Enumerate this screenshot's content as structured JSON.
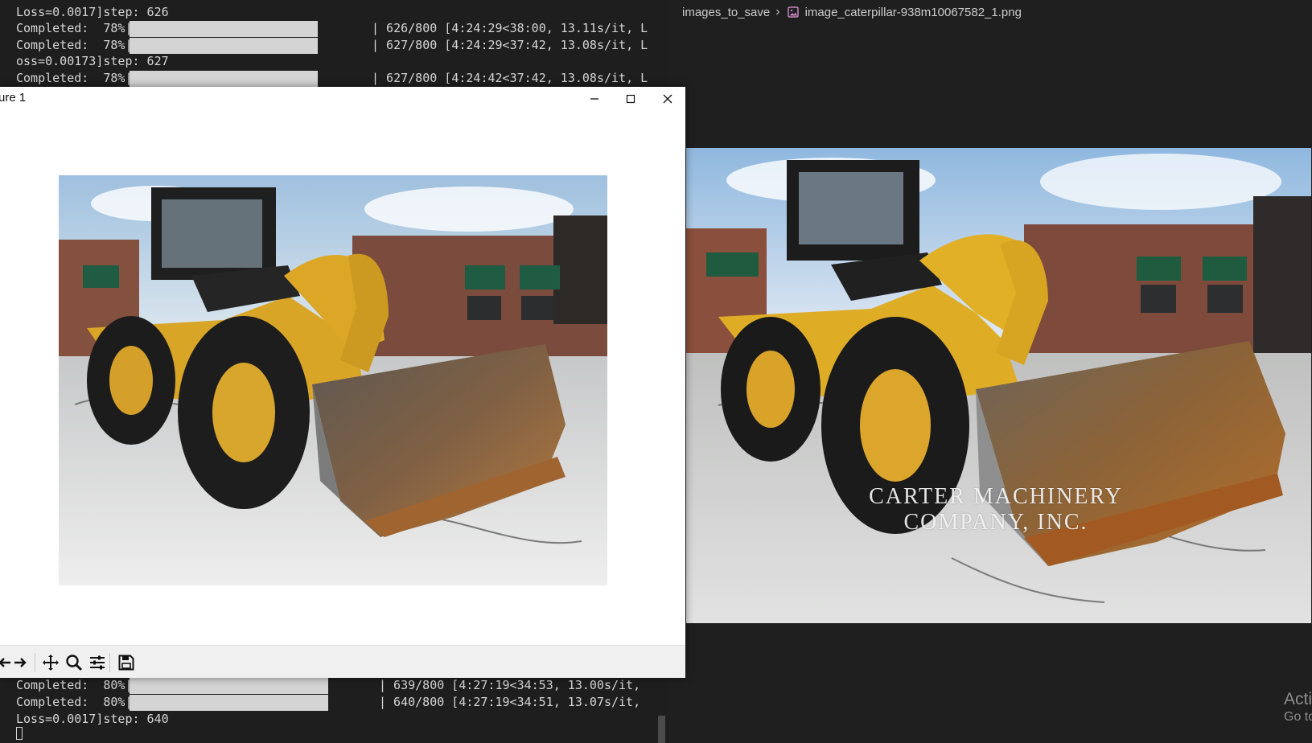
{
  "terminal": {
    "top_lines": [
      "Loss=0.0017]step: 626"
    ],
    "progress_top": [
      {
        "left": "Completed:  78%|",
        "right": "| 626/800 [4:24:29<38:00, 13.11s/it, L"
      },
      {
        "left": "Completed:  78%|",
        "right": "| 627/800 [4:24:29<37:42, 13.08s/it, L"
      }
    ],
    "middle_line": "oss=0.00173]step: 627",
    "progress_middle": {
      "left": "Completed:  78%|",
      "right": "| 627/800 [4:24:42<37:42, 13.08s/it, L"
    },
    "progress_bottom": [
      {
        "left": "Completed:  80%|",
        "right": "| 639/800 [4:27:19<34:53, 13.00s/it,"
      },
      {
        "left": "Completed:  80%|",
        "right": "| 640/800 [4:27:19<34:51, 13.07s/it,"
      }
    ],
    "last_line": "Loss=0.0017]step: 640",
    "colors": {
      "background": "#1e1e1e",
      "text": "#d6d6d6",
      "bar": "#d4d4d4"
    }
  },
  "figure": {
    "title": "ure 1",
    "controls": {
      "minimize_icon": "minimize-icon",
      "maximize_icon": "maximize-icon",
      "close_icon": "close-icon"
    },
    "toolbar_icons": [
      "back-arrow-icon",
      "forward-arrow-icon",
      "pan-icon",
      "zoom-icon",
      "configure-subplots-icon",
      "save-icon"
    ]
  },
  "viewer": {
    "breadcrumb": {
      "folder": "images_to_save",
      "file": "image_caterpillar-938m10067582_1.png"
    },
    "watermark": {
      "line1": "CARTER MACHINERY",
      "line2": "COMPANY, INC."
    }
  },
  "activation": {
    "line1": "Activ",
    "line2": "Go to"
  }
}
